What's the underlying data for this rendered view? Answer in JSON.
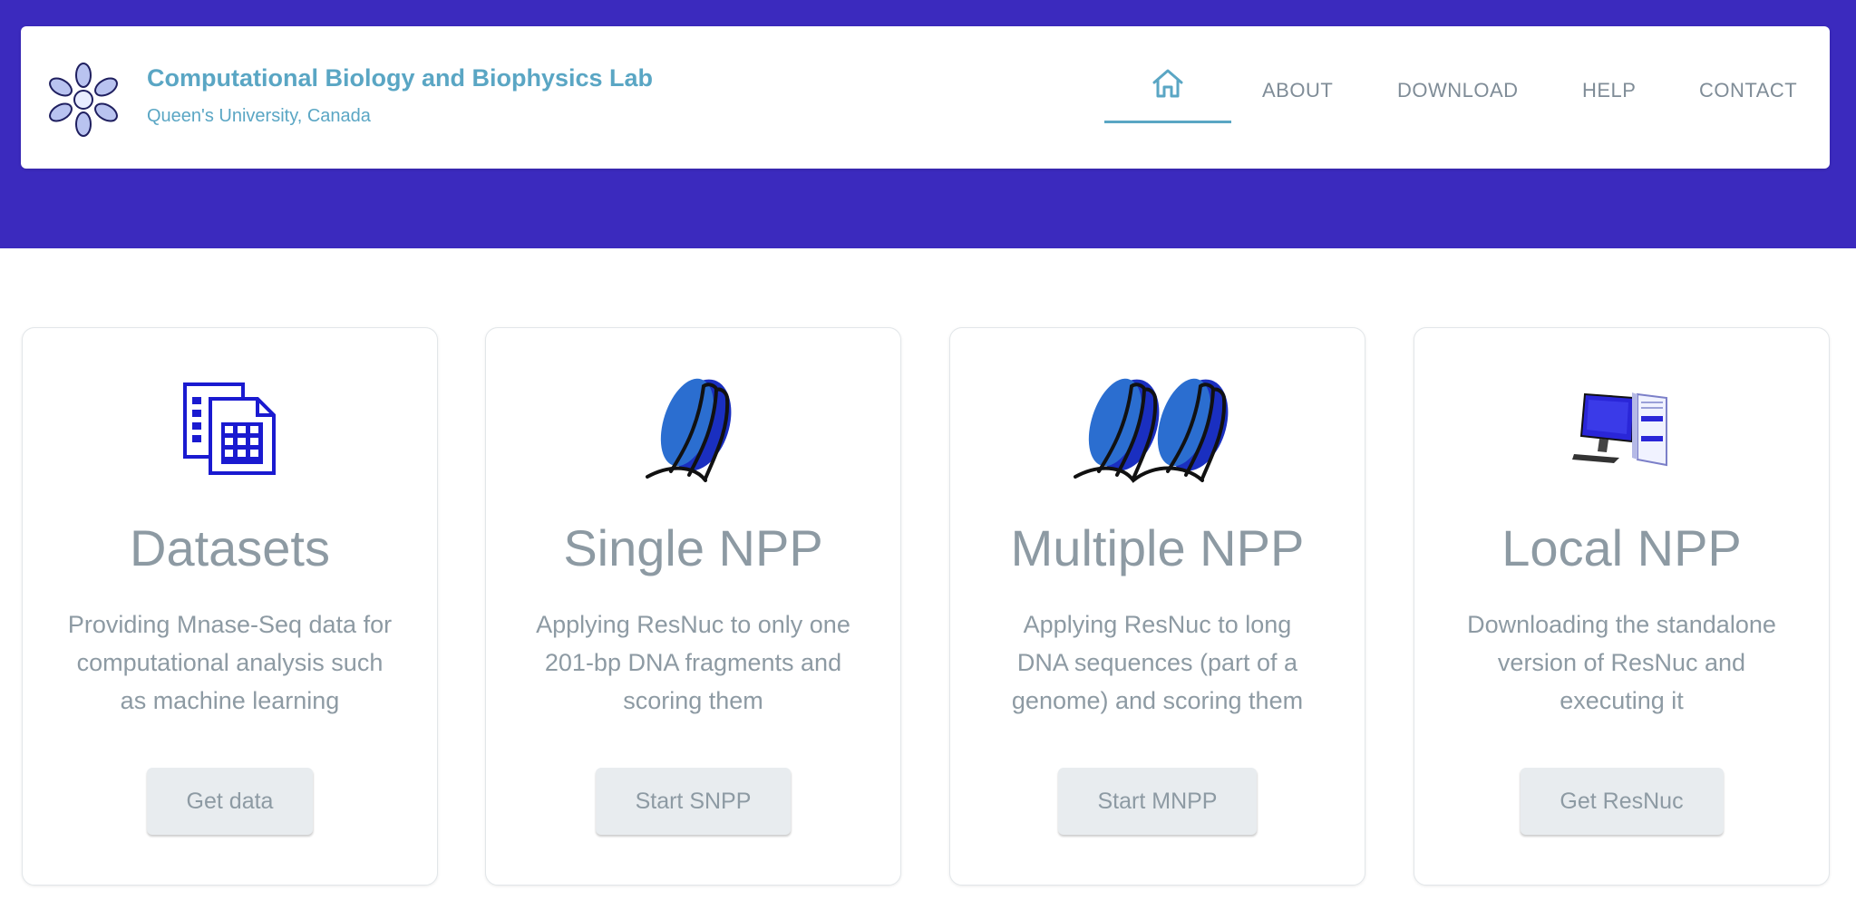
{
  "header": {
    "brand_title": "Computational Biology and Biophysics Lab",
    "brand_subtitle": "Queen's University, Canada",
    "hero_color": "#3b2abe",
    "accent_color": "#5aa6c4",
    "nav": {
      "home_icon": "home-icon",
      "items": [
        {
          "label": "ABOUT"
        },
        {
          "label": "DOWNLOAD"
        },
        {
          "label": "HELP"
        },
        {
          "label": "CONTACT"
        }
      ]
    }
  },
  "cards": [
    {
      "icon": "datasets-icon",
      "title": "Datasets",
      "description": "Providing Mnase-Seq data for computational analysis such as machine learning",
      "button": "Get data"
    },
    {
      "icon": "nucleosome-icon",
      "title": "Single NPP",
      "description": "Applying ResNuc to only one 201-bp DNA fragments and scoring them",
      "button": "Start SNPP"
    },
    {
      "icon": "double-nucleosome-icon",
      "title": "Multiple NPP",
      "description": "Applying ResNuc to long DNA sequences (part of a genome) and scoring them",
      "button": "Start MNPP"
    },
    {
      "icon": "computer-icon",
      "title": "Local NPP",
      "description": "Downloading the standalone version of ResNuc and executing it",
      "button": "Get ResNuc"
    }
  ]
}
